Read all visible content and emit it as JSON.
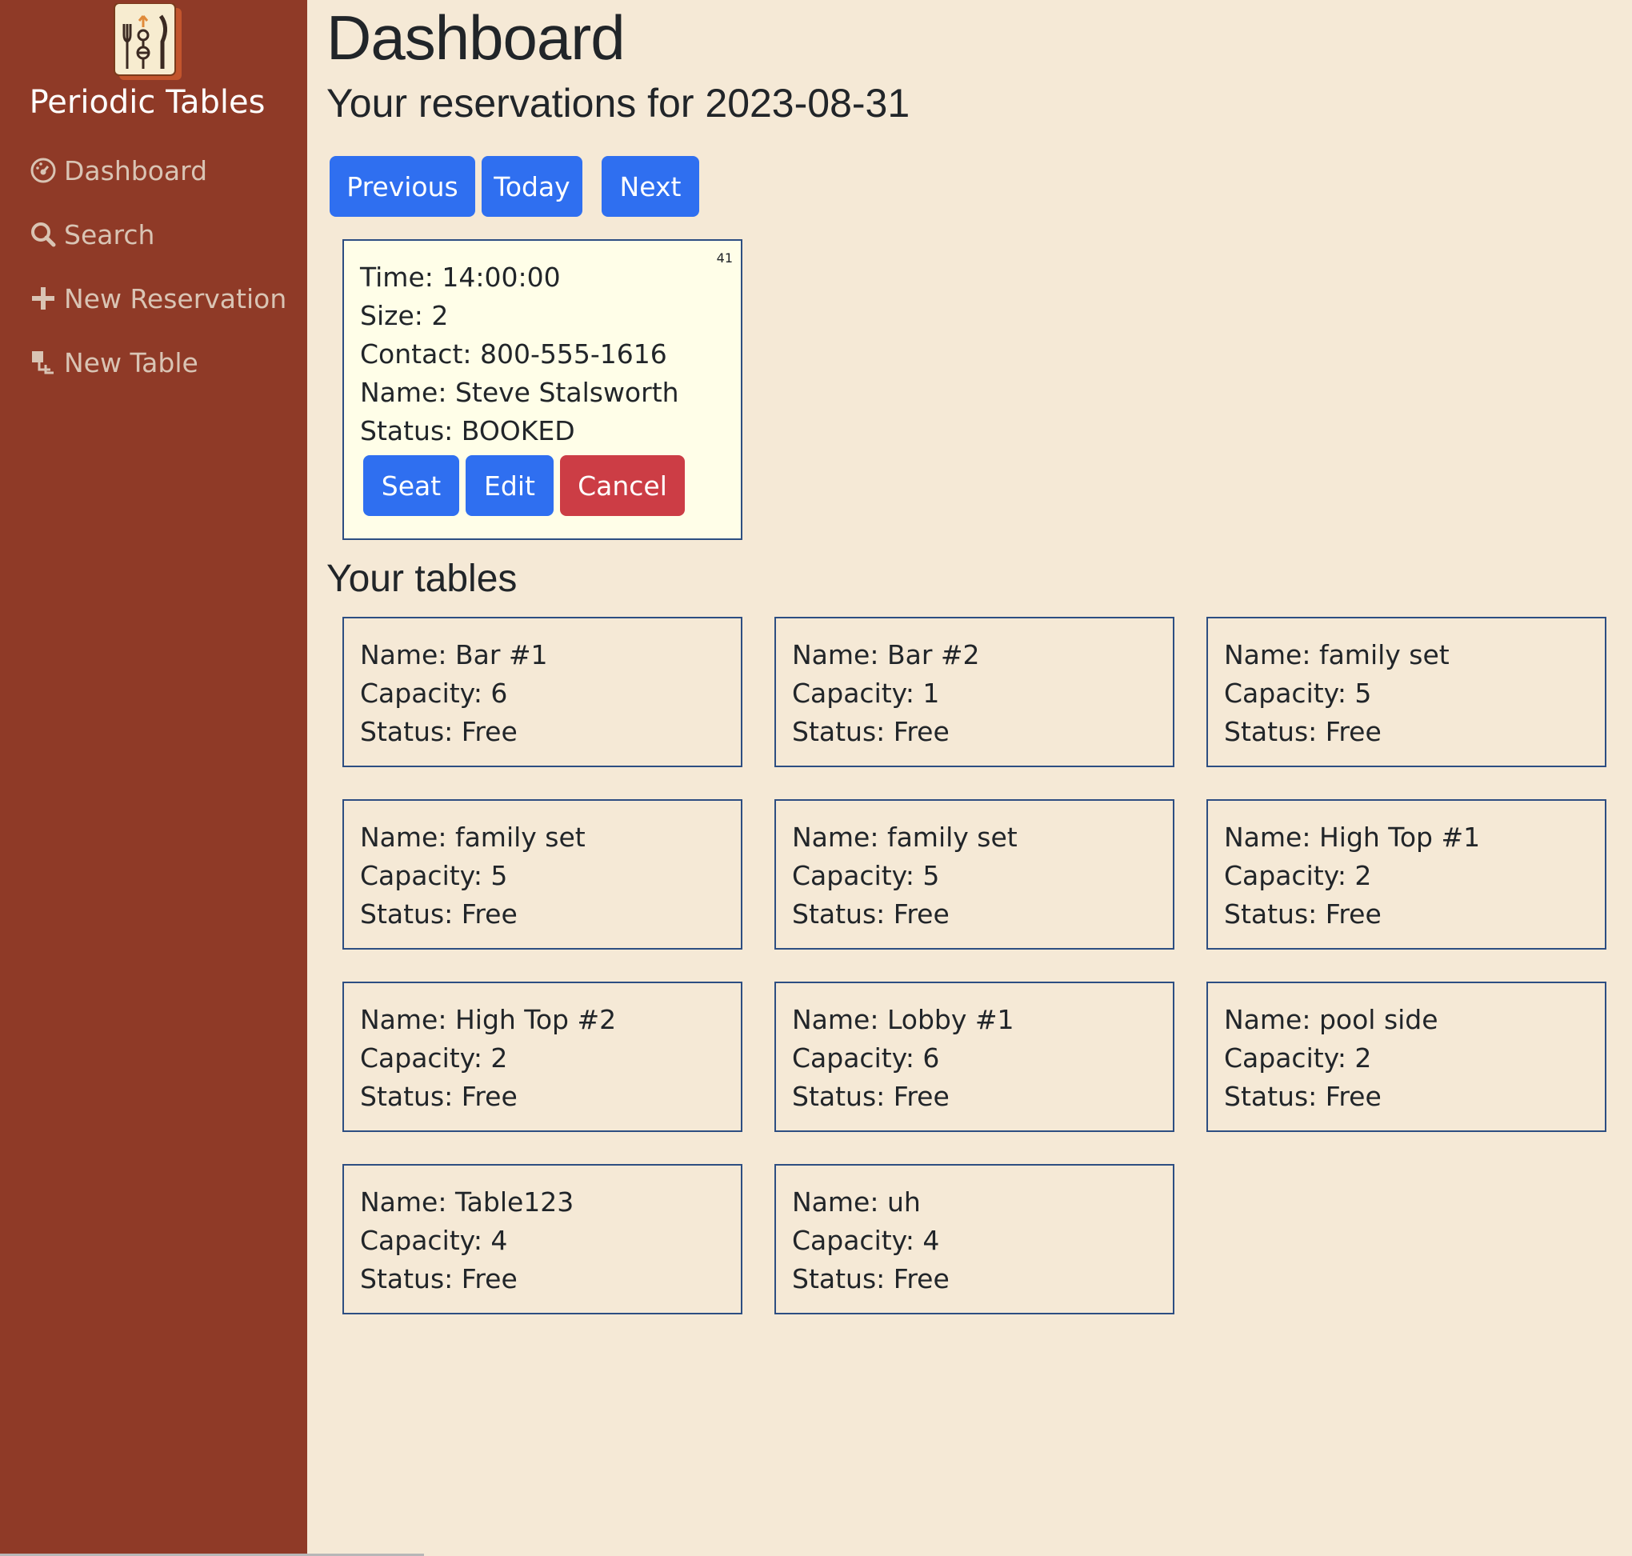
{
  "brand": {
    "name": "Periodic Tables",
    "logo_icon": "utensils-logo-icon"
  },
  "nav": [
    {
      "label": "Dashboard",
      "icon": "dashboard-icon"
    },
    {
      "label": "Search",
      "icon": "search-icon"
    },
    {
      "label": "New Reservation",
      "icon": "plus-icon"
    },
    {
      "label": "New Table",
      "icon": "layers-icon"
    }
  ],
  "header": {
    "title": "Dashboard",
    "subtitle": "Your reservations for 2023-08-31"
  },
  "date_nav": {
    "previous": "Previous",
    "today": "Today",
    "next": "Next"
  },
  "reservation": {
    "id": "41",
    "time": "Time: 14:00:00",
    "size": "Size: 2",
    "contact": "Contact: 800-555-1616",
    "name": "Name: Steve Stalsworth",
    "status": "Status: BOOKED",
    "seat_label": "Seat",
    "edit_label": "Edit",
    "cancel_label": "Cancel"
  },
  "tables_section": {
    "title": "Your tables"
  },
  "tables": [
    {
      "name": "Name: Bar #1",
      "capacity": "Capacity: 6",
      "status": "Status: Free"
    },
    {
      "name": "Name: Bar #2",
      "capacity": "Capacity: 1",
      "status": "Status: Free"
    },
    {
      "name": "Name: family set",
      "capacity": "Capacity: 5",
      "status": "Status: Free"
    },
    {
      "name": "Name: family set",
      "capacity": "Capacity: 5",
      "status": "Status: Free"
    },
    {
      "name": "Name: family set",
      "capacity": "Capacity: 5",
      "status": "Status: Free"
    },
    {
      "name": "Name: High Top #1",
      "capacity": "Capacity: 2",
      "status": "Status: Free"
    },
    {
      "name": "Name: High Top #2",
      "capacity": "Capacity: 2",
      "status": "Status: Free"
    },
    {
      "name": "Name: Lobby #1",
      "capacity": "Capacity: 6",
      "status": "Status: Free"
    },
    {
      "name": "Name: pool side",
      "capacity": "Capacity: 2",
      "status": "Status: Free"
    },
    {
      "name": "Name: Table123",
      "capacity": "Capacity: 4",
      "status": "Status: Free"
    },
    {
      "name": "Name: uh",
      "capacity": "Capacity: 4",
      "status": "Status: Free"
    }
  ],
  "colors": {
    "sidebar": "#8f3a27",
    "background": "#f5e9d6",
    "primary": "#2f6ff0",
    "danger": "#cc3d45",
    "card_border": "#2d4e82",
    "reservation_card": "#fffee8"
  }
}
